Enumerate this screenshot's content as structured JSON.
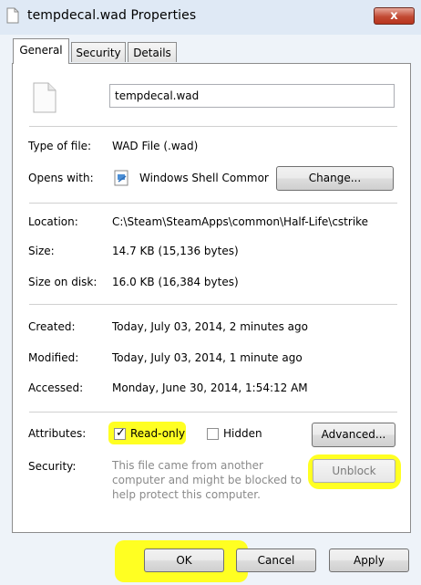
{
  "window": {
    "title": "tempdecal.wad Properties",
    "close_glyph": "x"
  },
  "tabs": [
    {
      "label": "General",
      "active": true
    },
    {
      "label": "Security",
      "active": false
    },
    {
      "label": "Details",
      "active": false
    }
  ],
  "general": {
    "file_name": "tempdecal.wad",
    "file_icon": "blank-document-icon",
    "type_of_file": {
      "label": "Type of file:",
      "value": "WAD File (.wad)"
    },
    "opens_with": {
      "label": "Opens with:",
      "value": "Windows Shell Commor",
      "icon": "windows-shell-icon",
      "button": "Change..."
    },
    "location": {
      "label": "Location:",
      "value": "C:\\Steam\\SteamApps\\common\\Half-Life\\cstrike"
    },
    "size": {
      "label": "Size:",
      "value": "14.7 KB (15,136 bytes)"
    },
    "size_on_disk": {
      "label": "Size on disk:",
      "value": "16.0 KB (16,384 bytes)"
    },
    "created": {
      "label": "Created:",
      "value": "Today, July 03, 2014, 2 minutes ago"
    },
    "modified": {
      "label": "Modified:",
      "value": "Today, July 03, 2014, 1 minute ago"
    },
    "accessed": {
      "label": "Accessed:",
      "value": "Monday, June 30, 2014, 1:54:12 AM"
    },
    "attributes": {
      "label": "Attributes:",
      "read_only": {
        "label": "Read-only",
        "checked": true
      },
      "hidden": {
        "label": "Hidden",
        "checked": false
      },
      "advanced_button": "Advanced..."
    },
    "security": {
      "label": "Security:",
      "note": "This file came from another computer and might be blocked to help protect this computer.",
      "unblock_button": "Unblock"
    }
  },
  "footer": {
    "ok": "OK",
    "cancel": "Cancel",
    "apply": "Apply"
  },
  "colors": {
    "highlight": "#ffff22",
    "frame": "#eef3f9",
    "close_button": "#c24a33"
  }
}
